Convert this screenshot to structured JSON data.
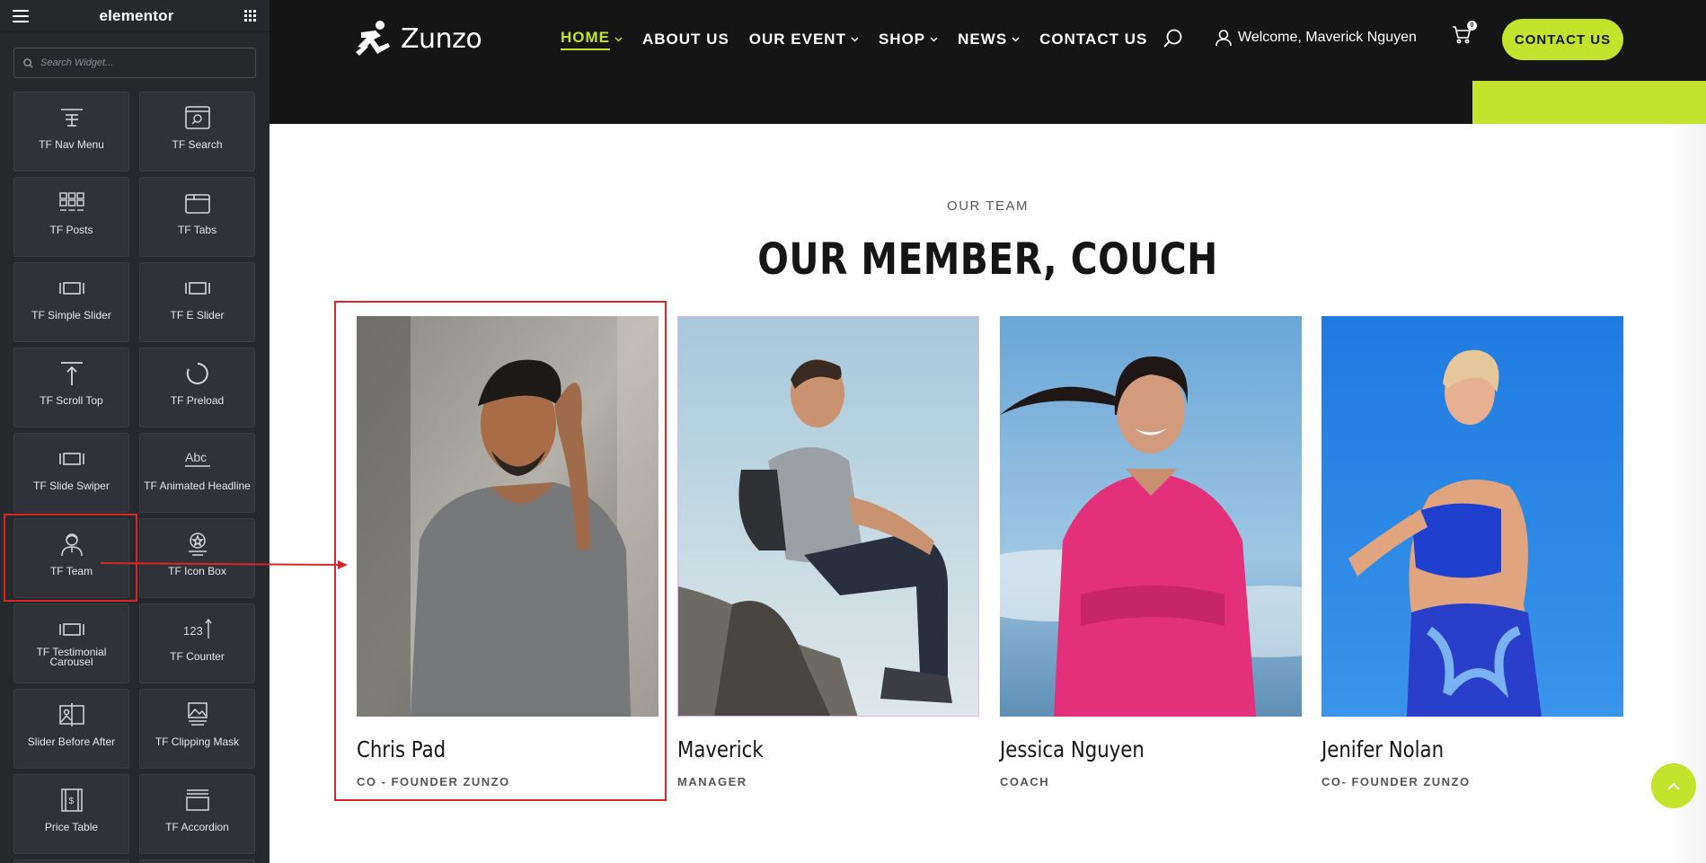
{
  "sidebar": {
    "logo": "elementor",
    "search_placeholder": "Search Widget...",
    "widgets": [
      {
        "label": "TF Nav Menu",
        "icon": "nav-menu-icon"
      },
      {
        "label": "TF Search",
        "icon": "search-widget-icon"
      },
      {
        "label": "TF Posts",
        "icon": "posts-grid-icon"
      },
      {
        "label": "TF Tabs",
        "icon": "tabs-icon"
      },
      {
        "label": "TF Simple Slider",
        "icon": "slider-icon"
      },
      {
        "label": "TF E Slider",
        "icon": "slider-icon"
      },
      {
        "label": "TF Scroll Top",
        "icon": "scroll-top-icon"
      },
      {
        "label": "TF Preload",
        "icon": "preload-icon"
      },
      {
        "label": "TF Slide Swiper",
        "icon": "slider-icon"
      },
      {
        "label": "TF Animated Headline",
        "icon": "animated-headline-icon"
      },
      {
        "label": "TF Team",
        "icon": "team-person-icon"
      },
      {
        "label": "TF Icon Box",
        "icon": "icon-box-icon"
      },
      {
        "label": "TF Testimonial Carousel",
        "icon": "slider-icon"
      },
      {
        "label": "TF Counter",
        "icon": "counter-icon"
      },
      {
        "label": "Slider Before After",
        "icon": "before-after-icon"
      },
      {
        "label": "TF Clipping Mask",
        "icon": "clipping-mask-icon"
      },
      {
        "label": "Price Table",
        "icon": "price-table-icon"
      },
      {
        "label": "TF Accordion",
        "icon": "accordion-icon"
      }
    ]
  },
  "header": {
    "brand": "Zunzo",
    "nav": [
      {
        "label": "HOME",
        "dropdown": true,
        "active": true
      },
      {
        "label": "ABOUT US",
        "dropdown": false
      },
      {
        "label": "OUR EVENT",
        "dropdown": true
      },
      {
        "label": "SHOP",
        "dropdown": true
      },
      {
        "label": "NEWS",
        "dropdown": true
      },
      {
        "label": "CONTACT US",
        "dropdown": false
      }
    ],
    "welcome": "Welcome, Maverick Nguyen",
    "cart_count": "0",
    "contact_button": "CONTACT US"
  },
  "team": {
    "eyebrow": "OUR TEAM",
    "title": "OUR MEMBER, COUCH",
    "members": [
      {
        "name": "Chris Pad",
        "role": "CO - FOUNDER ZUNZO"
      },
      {
        "name": "Maverick",
        "role": "MANAGER"
      },
      {
        "name": "Jessica Nguyen",
        "role": "COACH"
      },
      {
        "name": "Jenifer Nolan",
        "role": "CO- FOUNDER ZUNZO"
      }
    ]
  },
  "colors": {
    "accent": "#c4e32c",
    "header_bg": "#151515",
    "sidebar_bg": "#26292c",
    "highlight": "#d9262c"
  }
}
